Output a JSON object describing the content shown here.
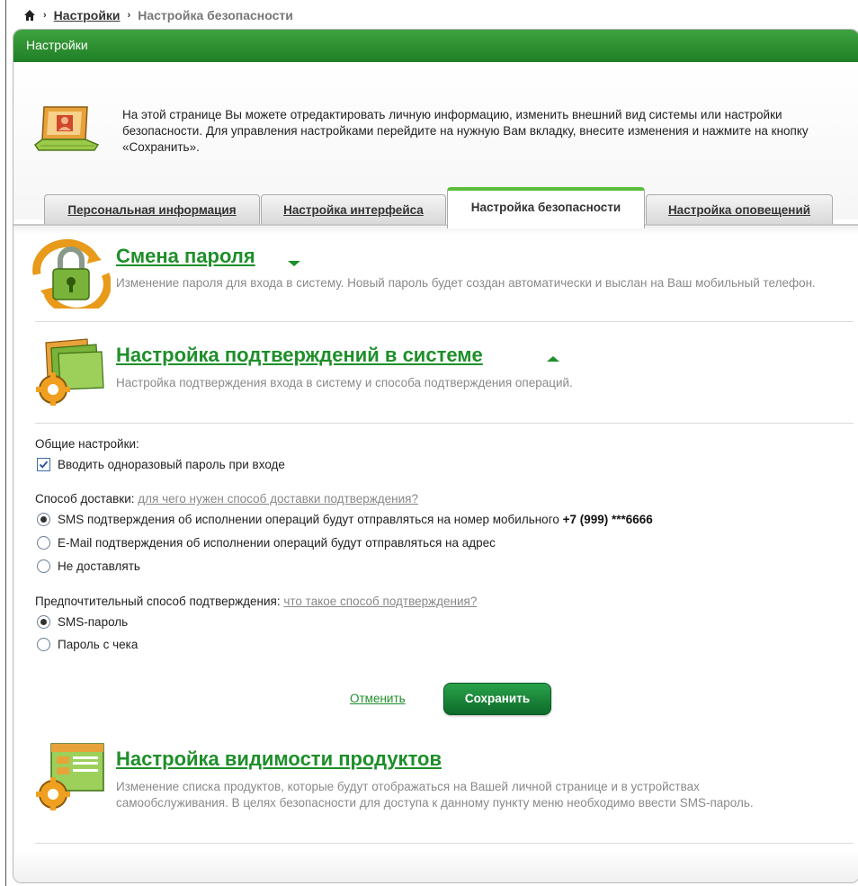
{
  "breadcrumb": {
    "home_icon": "home-icon",
    "separator": "›",
    "link": "Настройки",
    "current": "Настройка безопасности"
  },
  "panel": {
    "title": "Настройки",
    "intro": "На этой странице Вы можете отредактировать личную информацию, изменить внешний вид системы или настройки безопасности. Для управления настройками перейдите на нужную Вам вкладку, внесите изменения и нажмите на кнопку «Сохранить»."
  },
  "tabs": [
    {
      "label": "Персональная информация",
      "active": false
    },
    {
      "label": "Настройка интерфейса",
      "active": false
    },
    {
      "label": "Настройка безопасности",
      "active": true
    },
    {
      "label": "Настройка оповещений",
      "active": false
    }
  ],
  "sections": {
    "password": {
      "title": "Смена пароля",
      "desc": "Изменение пароля для входа в систему. Новый пароль будет создан автоматически и выслан на Ваш мобильный телефон.",
      "expanded": false
    },
    "confirm": {
      "title": "Настройка подтверждений в системе",
      "desc": "Настройка подтверждения входа в систему и способа подтверждения операций.",
      "expanded": true
    },
    "visibility": {
      "title": "Настройка видимости продуктов",
      "desc": "Изменение списка продуктов, которые будут отображаться на Вашей личной странице и в устройствах самообслуживания. В целях безопасности для доступа к данному пункту меню необходимо ввести SMS-пароль."
    }
  },
  "form": {
    "general_label": "Общие настройки:",
    "otp_checkbox": "Вводить одноразовый пароль при входе",
    "otp_checked": true,
    "delivery_label": "Способ доставки:",
    "delivery_help": "для чего нужен способ доставки подтверждения?",
    "delivery_options": [
      {
        "label": "SMS подтверждения об исполнении операций будут отправляться на номер мобильного",
        "extra": "+7 (999) ***6666",
        "selected": true
      },
      {
        "label": "E-Mail подтверждения об исполнении операций будут отправляться на адрес",
        "extra": "",
        "selected": false
      },
      {
        "label": "Не доставлять",
        "extra": "",
        "selected": false
      }
    ],
    "method_label": "Предпочтительный способ подтверждения:",
    "method_help": "что такое способ подтверждения?",
    "method_options": [
      {
        "label": "SMS-пароль",
        "selected": true
      },
      {
        "label": "Пароль с чека",
        "selected": false
      }
    ],
    "cancel": "Отменить",
    "save": "Сохранить"
  },
  "colors": {
    "accent_green": "#1e8f2a",
    "header_green": "#2e9533",
    "tab_active_border": "#5bbd3b"
  }
}
